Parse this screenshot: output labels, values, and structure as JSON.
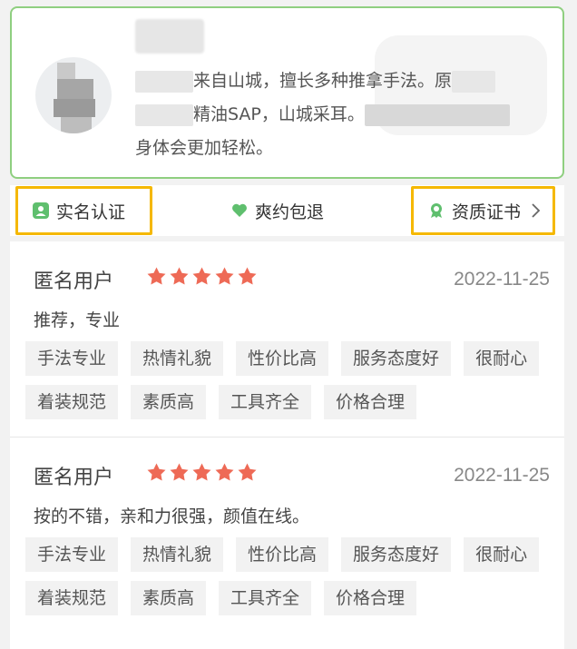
{
  "profile": {
    "bio_line1": "来自山城，擅长多种推拿手法。原",
    "bio_line2": "精油SAP，山城采耳。",
    "bio_line3": "身体会更加轻松。"
  },
  "badges": {
    "real_name": "实名认证",
    "refund": "爽约包退",
    "certificate": "资质证书"
  },
  "colors": {
    "accent_green": "#5fbf6e",
    "star_red": "#ee6a56",
    "highlight": "#f5b800"
  },
  "reviews": [
    {
      "user": "匿名用户",
      "rating": 5,
      "date": "2022-11-25",
      "text": "推荐，专业",
      "tags": [
        "手法专业",
        "热情礼貌",
        "性价比高",
        "服务态度好",
        "很耐心",
        "着装规范",
        "素质高",
        "工具齐全",
        "价格合理"
      ]
    },
    {
      "user": "匿名用户",
      "rating": 5,
      "date": "2022-11-25",
      "text": "按的不错，亲和力很强，颜值在线。",
      "tags": [
        "手法专业",
        "热情礼貌",
        "性价比高",
        "服务态度好",
        "很耐心",
        "着装规范",
        "素质高",
        "工具齐全",
        "价格合理"
      ]
    }
  ]
}
